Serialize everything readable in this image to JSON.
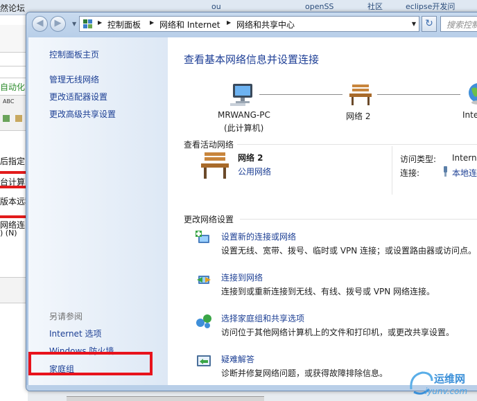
{
  "background_app": {
    "tab_fragment": "然论坛",
    "fragments": [
      "自动化",
      "后指定",
      "台计算",
      "版本远程",
      "网络连",
      ") (N)"
    ]
  },
  "background_tabs": [
    "ou",
    "openSS",
    "社区",
    "eclipse开发问"
  ],
  "nav": {
    "back_arrow": "◀",
    "forward_arrow": "▶",
    "history_arrow": "▼"
  },
  "address_bar": {
    "crumbs": [
      "控制面板",
      "网络和 Internet",
      "网络和共享中心"
    ],
    "separator": "▶",
    "dropdown_arrow": "▼"
  },
  "refresh_glyph": "↻",
  "search": {
    "placeholder": "搜索控制面"
  },
  "left_pane": {
    "links": [
      "控制面板主页",
      "管理无线网络",
      "更改适配器设置",
      "更改高级共享设置"
    ],
    "see_also_heading": "另请参阅",
    "see_also_links": [
      "Internet 选项",
      "Windows 防火墙",
      "家庭组"
    ]
  },
  "main": {
    "title": "查看基本网络信息并设置连接",
    "map": {
      "computer_name": "MRWANG-PC",
      "computer_sub": "(此计算机)",
      "network_name": "网络  2",
      "internet_label": "Inte"
    },
    "active_networks_heading": "查看活动网络",
    "active_network": {
      "name": "网络  2",
      "type": "公用网络",
      "access_type_label": "访问类型:",
      "access_type_value": "Interne",
      "connections_label": "连接:",
      "connections_value": "本地连"
    },
    "change_settings_heading": "更改网络设置",
    "tasks": [
      {
        "icon": "network-setup-icon",
        "title": "设置新的连接或网络",
        "desc": "设置无线、宽带、拨号、临时或 VPN 连接；或设置路由器或访问点。"
      },
      {
        "icon": "connect-network-icon",
        "title": "连接到网络",
        "desc": "连接到或重新连接到无线、有线、拨号或 VPN 网络连接。"
      },
      {
        "icon": "homegroup-icon",
        "title": "选择家庭组和共享选项",
        "desc": "访问位于其他网络计算机上的文件和打印机，或更改共享设置。"
      },
      {
        "icon": "troubleshoot-icon",
        "title": "疑难解答",
        "desc": "诊断并修复网络问题，或获得故障排除信息。"
      }
    ]
  },
  "watermark": {
    "text": "运维网",
    "url": "iyunv.com"
  },
  "colors": {
    "link": "#1c3f94",
    "highlight_box": "#e8131c",
    "title": "#1e3f96"
  }
}
